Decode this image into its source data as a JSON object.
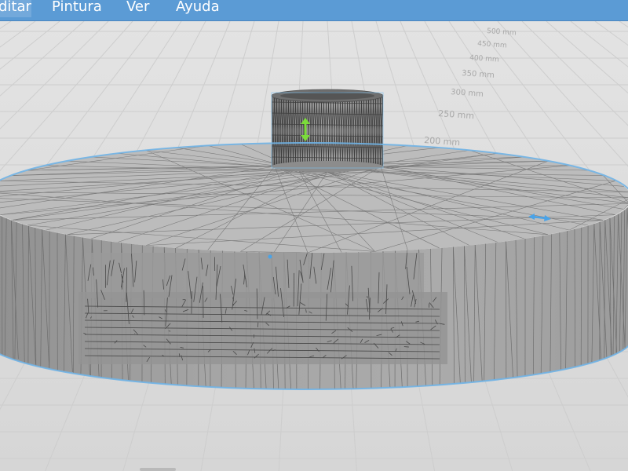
{
  "menu": {
    "items": [
      {
        "id": "editar",
        "label": "ditar"
      },
      {
        "id": "pintura",
        "label": "Pintura"
      },
      {
        "id": "ver",
        "label": "Ver"
      },
      {
        "id": "ayuda",
        "label": "Ayuda"
      }
    ]
  },
  "ruler": {
    "labels": [
      "500 mm",
      "450 mm",
      "400 mm",
      "350 mm",
      "300 mm",
      "250 mm",
      "200 mm"
    ]
  },
  "colors": {
    "menubar": "#5b9bd5",
    "selection_outline": "#6fb3e6",
    "move_gizmo_vertical": "#7bdc3b",
    "move_gizmo_horizontal": "#4aa3e8",
    "floor_grid": "#cfcfcf",
    "model_fill": "#a2a2a2"
  },
  "icons": {
    "vertical_gizmo": "double-arrow-vertical",
    "horizontal_gizmo": "double-arrow-horizontal",
    "center_marker": "dot"
  }
}
